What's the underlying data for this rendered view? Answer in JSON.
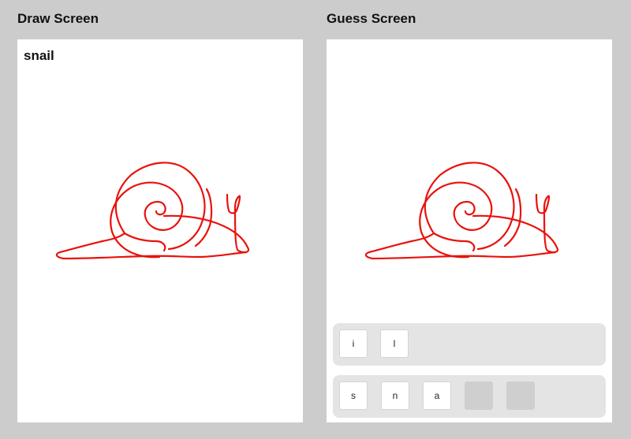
{
  "draw_screen": {
    "title": "Draw Screen",
    "word": "snail"
  },
  "guess_screen": {
    "title": "Guess Screen",
    "letter_pool": [
      "i",
      "l"
    ],
    "answer_letters": [
      "s",
      "n",
      "a",
      "",
      ""
    ]
  },
  "colors": {
    "stroke": "#e8120c",
    "background": "#cccccc",
    "tray": "#e4e4e4"
  }
}
